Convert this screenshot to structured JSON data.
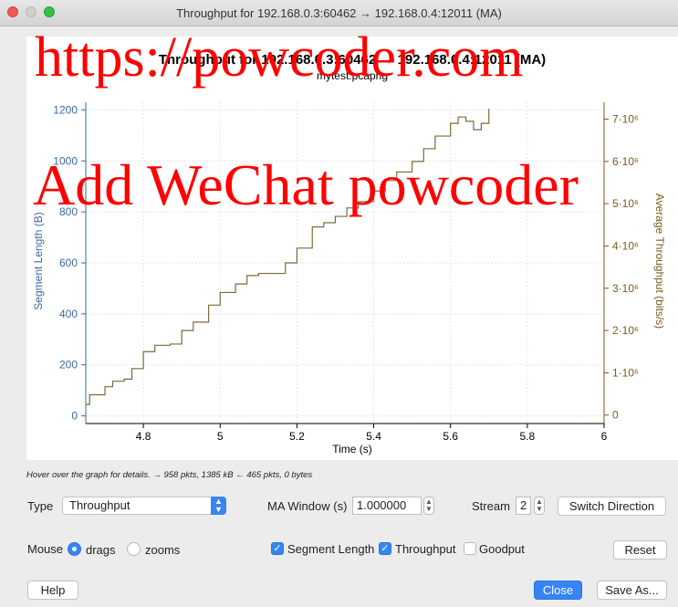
{
  "window": {
    "title": "Throughput for 192.168.0.3:60462 → 192.168.0.4:12011 (MA)"
  },
  "chart_data": {
    "type": "line",
    "title": "Throughput for 192.168.0.3:60462 → 192.168.0.4:12011 (MA)",
    "subtitle": "mytest.pcapng",
    "xlabel": "Time (s)",
    "ylabel": "Segment Length (B)",
    "y2label": "Average Throughput (bits/s)",
    "xlim": [
      4.65,
      6.0
    ],
    "ylim": [
      -30,
      1230
    ],
    "y2lim": [
      -200000,
      7400000
    ],
    "x_ticks": [
      4.8,
      5,
      5.2,
      5.4,
      5.6,
      5.8,
      6
    ],
    "x_tick_labels": [
      "4.8",
      "5",
      "5.2",
      "5.4",
      "5.6",
      "5.8",
      "6"
    ],
    "y_ticks": [
      0,
      200,
      400,
      600,
      800,
      1000,
      1200
    ],
    "y_tick_labels": [
      "0",
      "200",
      "400",
      "600",
      "800",
      "1000",
      "1200"
    ],
    "y2_ticks": [
      0,
      1000000,
      2000000,
      3000000,
      4000000,
      5000000,
      6000000,
      7000000
    ],
    "y2_tick_labels": [
      "0",
      "1·10⁶",
      "2·10⁶",
      "3·10⁶",
      "4·10⁶",
      "5·10⁶",
      "6·10⁶",
      "7·10⁶"
    ],
    "grid": true,
    "series": [
      {
        "name": "Throughput",
        "axis": "right",
        "color": "#7a6a3a",
        "x": [
          4.65,
          4.66,
          4.7,
          4.72,
          4.75,
          4.77,
          4.8,
          4.83,
          4.87,
          4.9,
          4.93,
          4.97,
          5.0,
          5.04,
          5.07,
          5.1,
          5.13,
          5.17,
          5.2,
          5.24,
          5.27,
          5.3,
          5.33,
          5.36,
          5.4,
          5.43,
          5.46,
          5.5,
          5.53,
          5.56,
          5.6,
          5.62,
          5.64,
          5.66,
          5.68,
          5.7
        ],
        "y": [
          250000,
          480000,
          670000,
          800000,
          850000,
          1100000,
          1500000,
          1650000,
          1680000,
          2000000,
          2200000,
          2600000,
          2900000,
          3100000,
          3300000,
          3350000,
          3350000,
          3600000,
          3950000,
          4450000,
          4550000,
          4700000,
          4900000,
          5050000,
          5300000,
          5550000,
          5750000,
          6000000,
          6300000,
          6600000,
          6900000,
          7050000,
          6950000,
          6750000,
          6900000,
          7250000
        ]
      }
    ]
  },
  "hint": "Hover over the graph for details. → 958 pkts, 1385 kB ← 465 pkts, 0 bytes",
  "controls": {
    "type_label": "Type",
    "type_value": "Throughput",
    "ma_label": "MA Window (s)",
    "ma_value": "1.000000",
    "stream_label": "Stream",
    "stream_value": "2",
    "switch_direction": "Switch Direction",
    "mouse_label": "Mouse",
    "drags_label": "drags",
    "zooms_label": "zooms",
    "segment_length_label": "Segment Length",
    "throughput_label": "Throughput",
    "goodput_label": "Goodput",
    "reset": "Reset",
    "help": "Help",
    "close": "Close",
    "save_as": "Save As..."
  },
  "watermark": {
    "line1": "https://powcoder.com",
    "line2": "Add WeChat powcoder"
  }
}
